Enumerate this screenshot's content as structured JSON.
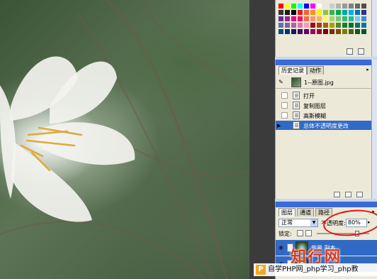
{
  "swatches": {
    "colors": [
      "#ff0000",
      "#ffff00",
      "#00ff00",
      "#00ffff",
      "#0000ff",
      "#ff00ff",
      "#ffffff",
      "#e6e6e6",
      "#cccccc",
      "#b3b3b3",
      "#999999",
      "#808080",
      "#666666",
      "#4d4d4d",
      "#333333",
      "#1a1a1a",
      "#000000",
      "#ed1c24",
      "#f26522",
      "#f7941d",
      "#fff200",
      "#8dc63f",
      "#39b54a",
      "#00a651",
      "#00a99d",
      "#00aeef",
      "#0072bc",
      "#2e3192",
      "#662d91",
      "#92278f",
      "#ec008c",
      "#ed145b",
      "#f26c4f",
      "#f69679",
      "#fbaf5d",
      "#fff568",
      "#acd373",
      "#7cc576",
      "#3cb878",
      "#1abc9c",
      "#6dcff6",
      "#448ccb",
      "#5674b9",
      "#8560a8",
      "#a864a8",
      "#f06eaa",
      "#f49ac2",
      "#9e0b0f",
      "#a0410d",
      "#a3620a",
      "#aba000",
      "#598527",
      "#197b30",
      "#007236",
      "#00746b",
      "#0076a3",
      "#004a80",
      "#003471",
      "#1b1464",
      "#440e62",
      "#630460",
      "#9e005d",
      "#9e0039",
      "#790000",
      "#7b2e00",
      "#7d4900",
      "#827b00",
      "#406618",
      "#005e20",
      "#005826"
    ]
  },
  "history": {
    "tabs": [
      "历史记录",
      "动作"
    ],
    "snapshot": "1--原图.jpg",
    "steps": [
      {
        "label": "打开",
        "selected": false
      },
      {
        "label": "复制图层",
        "selected": false
      },
      {
        "label": "高斯模糊",
        "selected": false
      },
      {
        "label": "总体不透明度更改",
        "selected": true
      }
    ]
  },
  "layers": {
    "tabs": [
      "图层",
      "通道",
      "路径"
    ],
    "blend_mode": "正常",
    "opacity_label": "不透明度:",
    "opacity_value": "80%",
    "opacity_fraction": 0.8,
    "lock_label": "锁定:",
    "rows": [
      {
        "name": "背景 副本",
        "selected": true
      },
      {
        "name": "",
        "selected": true
      }
    ]
  },
  "watermark": {
    "logo": "知行网",
    "banner": "自学PHP网_php学习_php教",
    "banner_icon": "P"
  },
  "colors": {
    "panel_bg": "#ece9d8",
    "title_bar": "#3a6ad6",
    "selection": "#316ac5",
    "annotation": "#e01515"
  }
}
